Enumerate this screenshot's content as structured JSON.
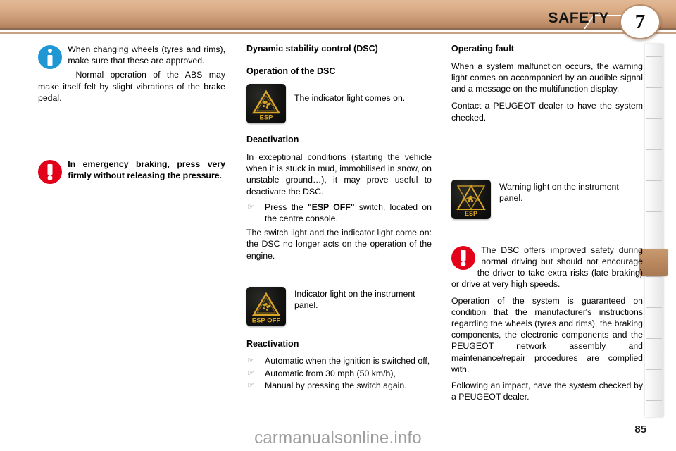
{
  "header": {
    "title": "SAFETY",
    "chapter_number": "7"
  },
  "left_column": {
    "info_callout": {
      "icon": "info-icon",
      "paragraph_1": "When changing wheels (tyres and rims), make sure that these are approved.",
      "paragraph_2": "Normal operation of the ABS may make itself felt by slight vibrations of the brake pedal."
    },
    "warning_callout": {
      "icon": "warning-exclamation-icon",
      "text": "In emergency braking, press very firmly without releasing the pressure."
    }
  },
  "middle_column": {
    "section_title": "Dynamic stability control (DSC)",
    "operation": {
      "heading": "Operation of the DSC",
      "indicator_icon": "esp-indicator-light-icon",
      "indicator_text": "The indicator light comes on."
    },
    "deactivation": {
      "heading": "Deactivation",
      "paragraph_1": "In exceptional conditions (starting the vehicle when it is stuck in mud, immobilised in snow, on unstable ground…), it may prove useful to deactivate the DSC.",
      "bullet_1_pre": "Press the ",
      "bullet_1_bold": "\"ESP OFF\"",
      "bullet_1_post": " switch, located on the centre console.",
      "paragraph_2": "The switch light and the indicator light come on: the DSC no longer acts on the operation of the engine."
    },
    "esp_off_icon": "esp-off-indicator-light-icon",
    "esp_off_caption": "Indicator light on the instrument panel.",
    "reactivation": {
      "heading": "Reactivation",
      "bullets": [
        "Automatic when the ignition is switched off,",
        "Automatic from 30 mph (50 km/h),",
        "Manual by pressing the switch again."
      ]
    }
  },
  "right_column": {
    "operating_fault": {
      "heading": "Operating fault",
      "paragraph_1": "When a system malfunction occurs, the warning light comes on accompanied by an audible signal and a message on the multifunction display.",
      "paragraph_2": "Contact a PEUGEOT dealer to have the system checked."
    },
    "warning_light": {
      "icon": "esp-warning-light-icon",
      "caption": "Warning light on the instrument panel."
    },
    "dsc_warning": {
      "icon": "warning-exclamation-icon",
      "paragraph_1": "The DSC offers improved safety during normal driving but should not encourage the driver to take extra risks (late braking) or drive at very high speeds.",
      "paragraph_2": "Operation of the system is guaranteed on condition that the manufacturer's instructions regarding the wheels (tyres and rims), the braking components, the electronic components and the PEUGEOT network assembly and maintenance/repair procedures are complied with.",
      "paragraph_3": "Following an impact, have the system checked by a PEUGEOT dealer."
    }
  },
  "footer": {
    "page_number": "85",
    "watermark": "carmanualsonline.info"
  },
  "tell_tale_labels": {
    "esp": "ESP",
    "esp_off": "ESP OFF"
  },
  "colors": {
    "header_band": "#dcaf89",
    "tab_marker": "#b9875e",
    "info_blue": "#1f97d4",
    "warning_red": "#e2001a",
    "tell_tale_amber": "#d9a526"
  }
}
